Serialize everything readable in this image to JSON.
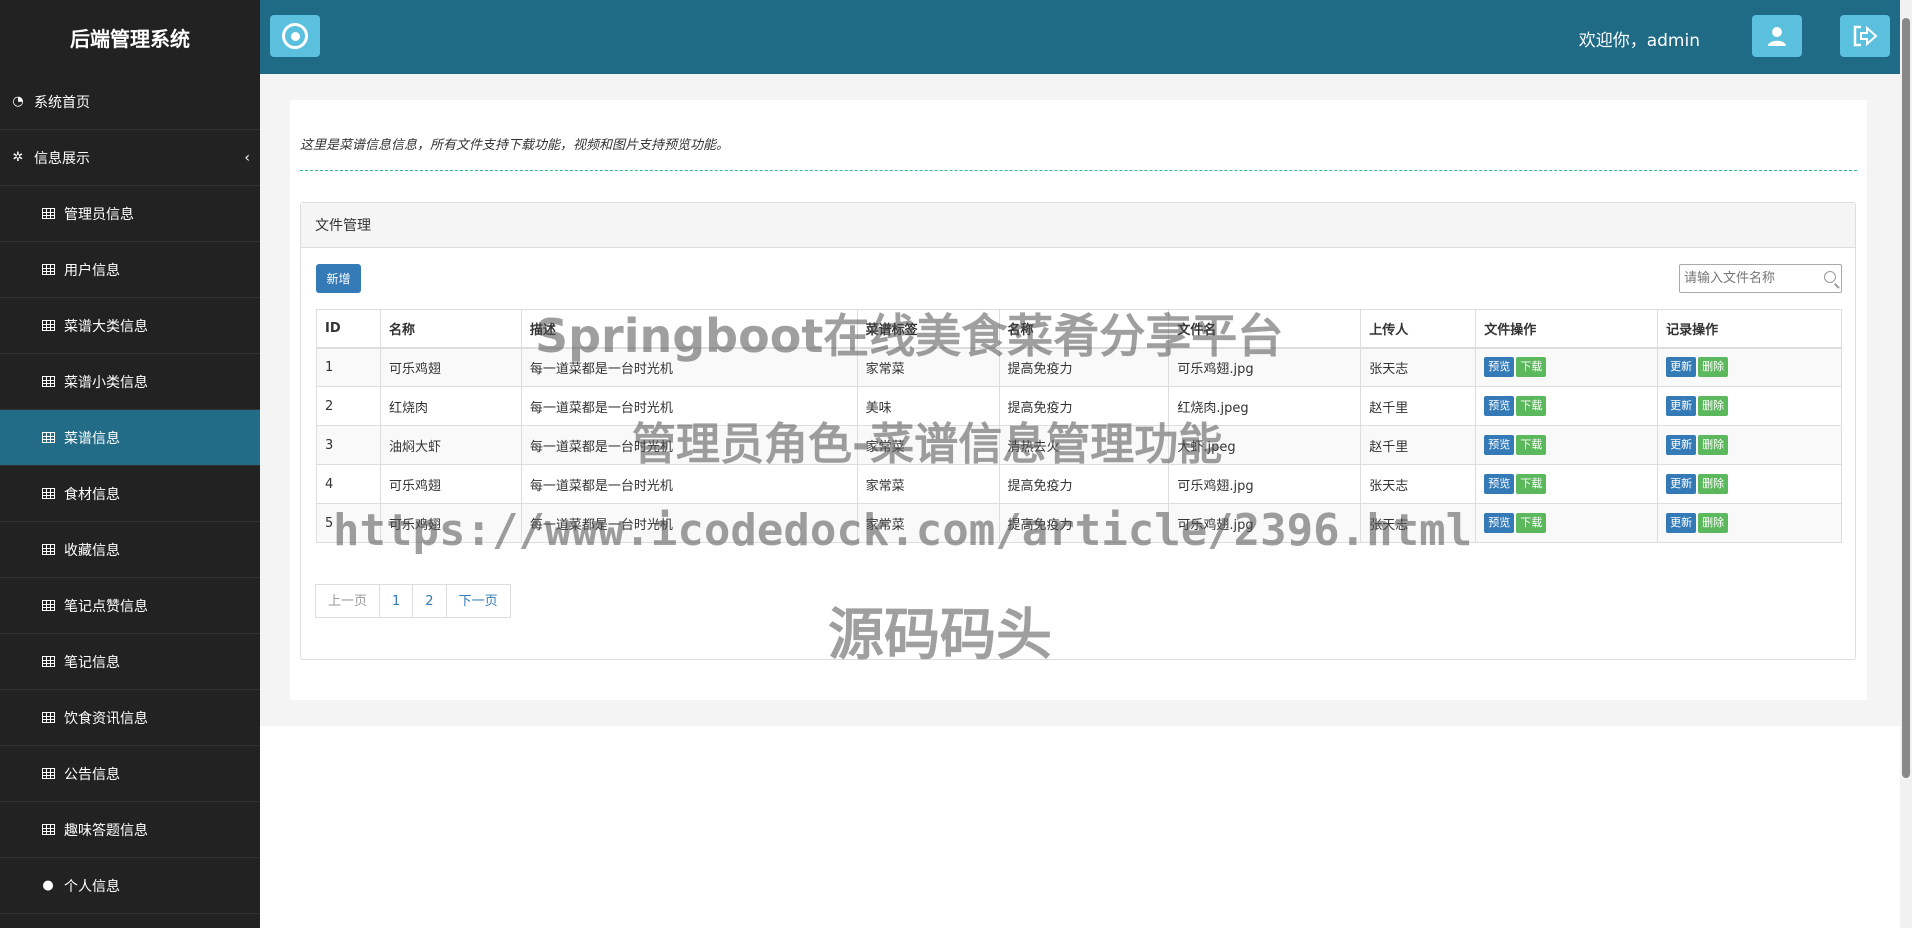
{
  "app": {
    "title": "后端管理系统"
  },
  "sidebar": {
    "items": [
      {
        "label": "系统首页",
        "icon": "dashboard-icon"
      },
      {
        "label": "信息展示",
        "icon": "cubes-icon"
      },
      {
        "label": "管理员信息",
        "icon": "table-icon"
      },
      {
        "label": "用户信息",
        "icon": "table-icon"
      },
      {
        "label": "菜谱大类信息",
        "icon": "table-icon"
      },
      {
        "label": "菜谱小类信息",
        "icon": "table-icon"
      },
      {
        "label": "菜谱信息",
        "icon": "table-icon"
      },
      {
        "label": "食材信息",
        "icon": "table-icon"
      },
      {
        "label": "收藏信息",
        "icon": "table-icon"
      },
      {
        "label": "笔记点赞信息",
        "icon": "table-icon"
      },
      {
        "label": "笔记信息",
        "icon": "table-icon"
      },
      {
        "label": "饮食资讯信息",
        "icon": "table-icon"
      },
      {
        "label": "公告信息",
        "icon": "table-icon"
      },
      {
        "label": "趣味答题信息",
        "icon": "table-icon"
      },
      {
        "label": "个人信息",
        "icon": "user-icon"
      }
    ]
  },
  "header": {
    "welcome": "欢迎你，admin"
  },
  "main": {
    "intro": "这里是菜谱信息信息，所有文件支持下载功能，视频和图片支持预览功能。",
    "panel_title": "文件管理",
    "add_button": "新增",
    "search_placeholder": "请输入文件名称",
    "columns": [
      "ID",
      "名称",
      "描述",
      "菜谱标签",
      "名称",
      "文件名",
      "上传人",
      "文件操作",
      "记录操作"
    ],
    "rows": [
      [
        "1",
        "可乐鸡翅",
        "每一道菜都是一台时光机",
        "家常菜",
        "提高免疫力",
        "可乐鸡翅.jpg",
        "张天志"
      ],
      [
        "2",
        "红烧肉",
        "每一道菜都是一台时光机",
        "美味",
        "提高免疫力",
        "红烧肉.jpeg",
        "赵千里"
      ],
      [
        "3",
        "油焖大虾",
        "每一道菜都是一台时光机",
        "家常菜",
        "清热去火",
        "大虾.jpeg",
        "赵千里"
      ],
      [
        "4",
        "可乐鸡翅",
        "每一道菜都是一台时光机",
        "家常菜",
        "提高免疫力",
        "可乐鸡翅.jpg",
        "张天志"
      ],
      [
        "5",
        "可乐鸡翅",
        "每一道菜都是一台时光机",
        "家常菜",
        "提高免疫力",
        "可乐鸡翅.jpg",
        "张天志"
      ]
    ],
    "file_actions": {
      "preview": "预览",
      "download": "下载"
    },
    "record_actions": {
      "update": "更新",
      "delete": "删除"
    },
    "pager": {
      "prev": "上一页",
      "pages": [
        "1",
        "2"
      ],
      "next": "下一页"
    }
  },
  "watermarks": {
    "line1": "Springboot在线美食菜肴分享平台",
    "line2": "管理员角色-菜谱信息管理功能",
    "line3": "https://www.icodedock.com/article/2396.html",
    "line4": "源码码头"
  }
}
